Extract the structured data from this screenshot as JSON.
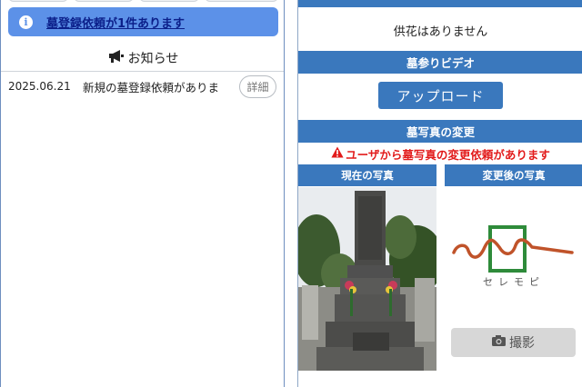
{
  "left": {
    "alert": {
      "icon": "info-icon",
      "link_text": "墓登録依頼が1件あります"
    },
    "notice": {
      "heading": "お知らせ",
      "icon": "megaphone-icon",
      "items": [
        {
          "date": "2025.06.21",
          "text": "新規の墓登録依頼がありま",
          "button_label": "詳細"
        }
      ]
    }
  },
  "right": {
    "flowers_message": "供花はありません",
    "video": {
      "header": "墓参りビデオ",
      "upload_label": "アップロード"
    },
    "photo": {
      "header": "墓写真の変更",
      "warning": "ユーザから墓写真の変更依頼があります",
      "current_label": "現在の写真",
      "new_label": "変更後の写真",
      "logo_text": "セレモピ",
      "capture_label": "撮影"
    }
  },
  "colors": {
    "primary": "#3a78bd",
    "alert_bg": "#5c91e8",
    "warning": "#e21b1b",
    "logo_green": "#2e8b3a",
    "logo_orange": "#c0532a"
  }
}
